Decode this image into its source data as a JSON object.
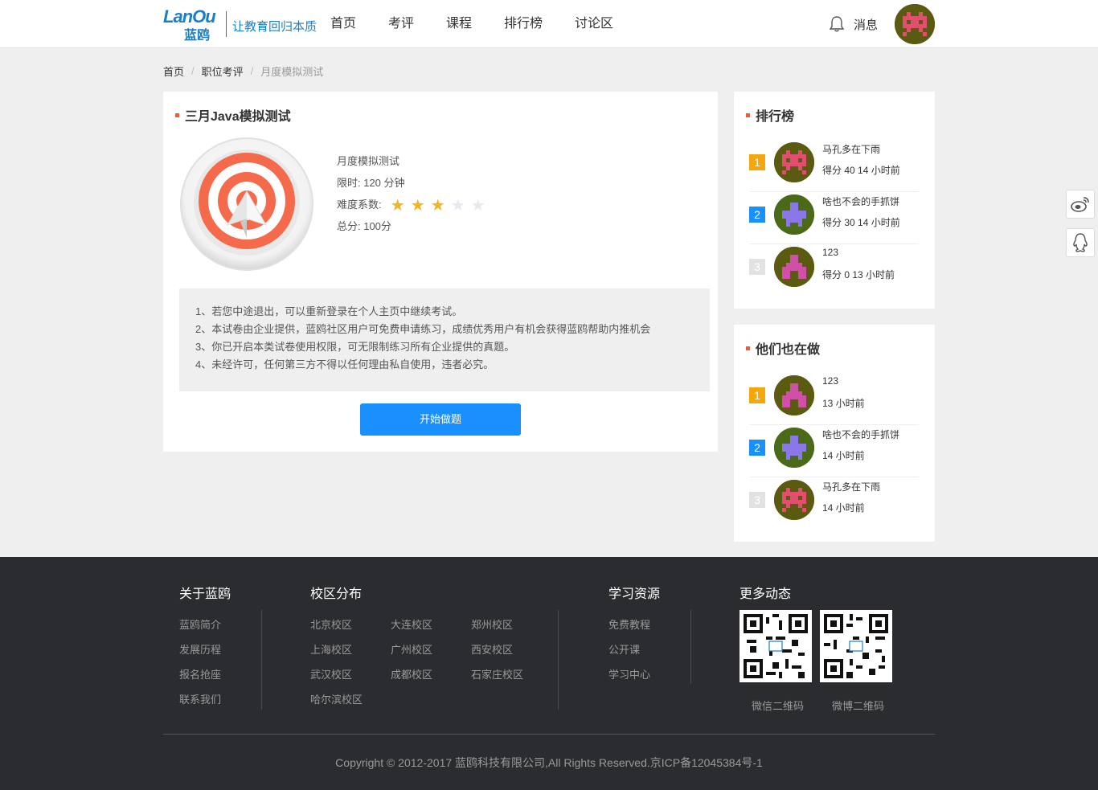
{
  "header": {
    "logo_en": "LanOu",
    "logo_cn": "蓝鸥",
    "slogan": "让教育回归本质",
    "nav": [
      "首页",
      "考评",
      "课程",
      "排行榜",
      "讨论区"
    ],
    "message_label": "消息",
    "avatar_color": "#5a5a10"
  },
  "breadcrumb": {
    "home": "首页",
    "section": "职位考评",
    "current": "月度模拟测试",
    "sep": "/"
  },
  "exam": {
    "title": "三月Java模拟测试",
    "type": "月度模拟测试",
    "time_limit": "限时: 120 分钟",
    "difficulty_label": "难度系数:",
    "difficulty_stars": 3,
    "difficulty_max": 5,
    "total_score": "总分: 100分",
    "notices": [
      "1、若您中途退出，可以重新登录在个人主页中继续考试。",
      "2、本试卷由企业提供，蓝鸥社区用户可免费申请练习，成绩优秀用户有机会获得蓝鸥帮助内推机会",
      "3、你已开启本类试卷使用权限，可无限制练习所有企业提供的真题。",
      "4、未经许可，任何第三方不得以任何理由私自使用，违者必究。"
    ],
    "start_button": "开始做题"
  },
  "ranking": {
    "title": "排行榜",
    "items": [
      {
        "rank": "1",
        "name": "马孔多在下雨",
        "meta": "得分 40 14 小时前"
      },
      {
        "rank": "2",
        "name": "啥也不会的手抓饼",
        "meta": "得分 30 14 小时前"
      },
      {
        "rank": "3",
        "name": "123",
        "meta": "得分 0 13 小时前"
      }
    ]
  },
  "also_doing": {
    "title": "他们也在做",
    "items": [
      {
        "rank": "1",
        "name": "123",
        "meta": "13 小时前"
      },
      {
        "rank": "2",
        "name": "啥也不会的手抓饼",
        "meta": "14 小时前"
      },
      {
        "rank": "3",
        "name": "马孔多在下雨",
        "meta": "14 小时前"
      }
    ]
  },
  "footer": {
    "about": {
      "title": "关于蓝鸥",
      "links": [
        "蓝鸥简介",
        "发展历程",
        "报名抢座",
        "联系我们"
      ]
    },
    "campus": {
      "title": "校区分布",
      "links": [
        "北京校区",
        "大连校区",
        "郑州校区",
        "上海校区",
        "广州校区",
        "西安校区",
        "武汉校区",
        "成都校区",
        "石家庄校区",
        "哈尔滨校区"
      ]
    },
    "resources": {
      "title": "学习资源",
      "links": [
        "免费教程",
        "公开课",
        "学习中心"
      ]
    },
    "more": {
      "title": "更多动态",
      "wechat_qr": "微信二维码",
      "weibo_qr": "微博二维码"
    },
    "copyright": "Copyright © 2012-2017 蓝鸥科技有限公司,All Rights Reserved.京ICP备12045384号-1"
  },
  "colors": {
    "accent": "#1a90ff",
    "title_marker": "#f05a3c",
    "rank1": "#f5a60a",
    "rank2": "#1a90ff",
    "rank3": "#e2e2e2",
    "star_on": "#f5b31e",
    "footer_bg": "#2b2c2f"
  },
  "icons": {
    "bell": "bell-icon",
    "weibo": "weibo-icon",
    "qq": "qq-icon",
    "exam_badge": "target-badge-icon"
  }
}
